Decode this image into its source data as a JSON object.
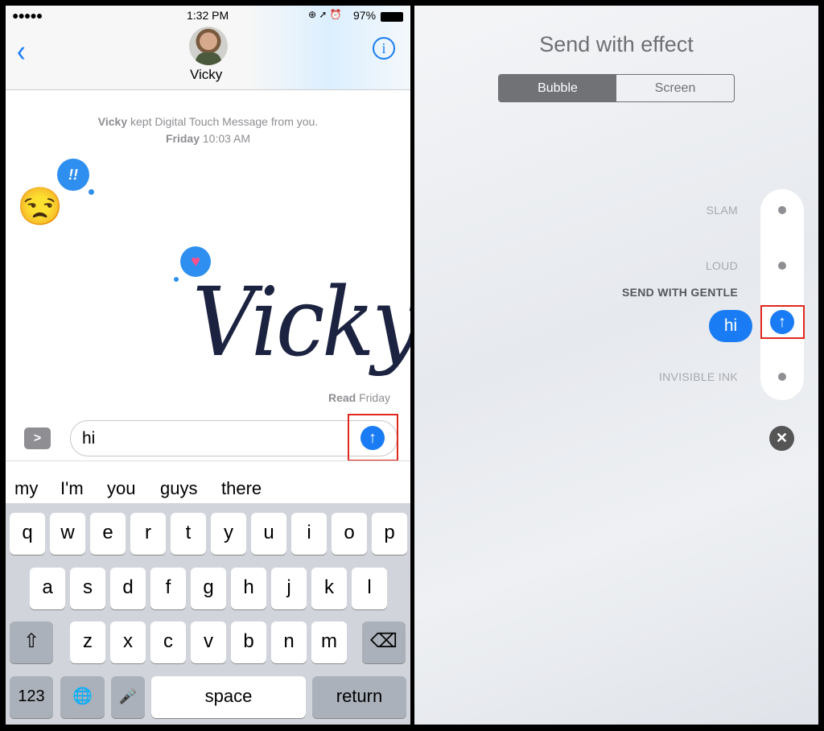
{
  "status": {
    "signal": "●●●●●",
    "time": "1:32 PM",
    "icons": "⊕ ➚ ⏰",
    "battery": "97%"
  },
  "header": {
    "back_icon": "chevron-left",
    "contact_name": "Vicky",
    "info_icon": "i"
  },
  "conversation": {
    "notice_name": "Vicky",
    "notice_text": " kept Digital Touch Message from you.",
    "notice_day": "Friday",
    "notice_time": " 10:03 AM",
    "bubble_icon_1": "!!",
    "emoji_face": "😒",
    "handwriting": "Vicky",
    "read_label": "Read",
    "read_day": " Friday"
  },
  "composer": {
    "expand_icon": ">",
    "input_value": "hi",
    "send_icon": "↑"
  },
  "suggestions": [
    "my",
    "I'm",
    "you",
    "guys",
    "there"
  ],
  "keyboard": {
    "row1": [
      "q",
      "w",
      "e",
      "r",
      "t",
      "y",
      "u",
      "i",
      "o",
      "p"
    ],
    "row2": [
      "a",
      "s",
      "d",
      "f",
      "g",
      "h",
      "j",
      "k",
      "l"
    ],
    "row3": [
      "z",
      "x",
      "c",
      "v",
      "b",
      "n",
      "m"
    ],
    "shift": "⇧",
    "delete": "⌫",
    "numbers": "123",
    "globe": "🌐",
    "mic": "🎤",
    "space": "space",
    "return": "return"
  },
  "effect": {
    "title": "Send with effect",
    "tabs": [
      {
        "label": "Bubble",
        "selected": true
      },
      {
        "label": "Screen",
        "selected": false
      }
    ],
    "options": [
      "SLAM",
      "LOUD",
      "SEND WITH GENTLE",
      "INVISIBLE INK"
    ],
    "bubble_text": "hi",
    "send_icon": "↑",
    "close_icon": "✕"
  },
  "colors": {
    "accent": "#1a7cf5",
    "highlight": "#e0281e"
  }
}
